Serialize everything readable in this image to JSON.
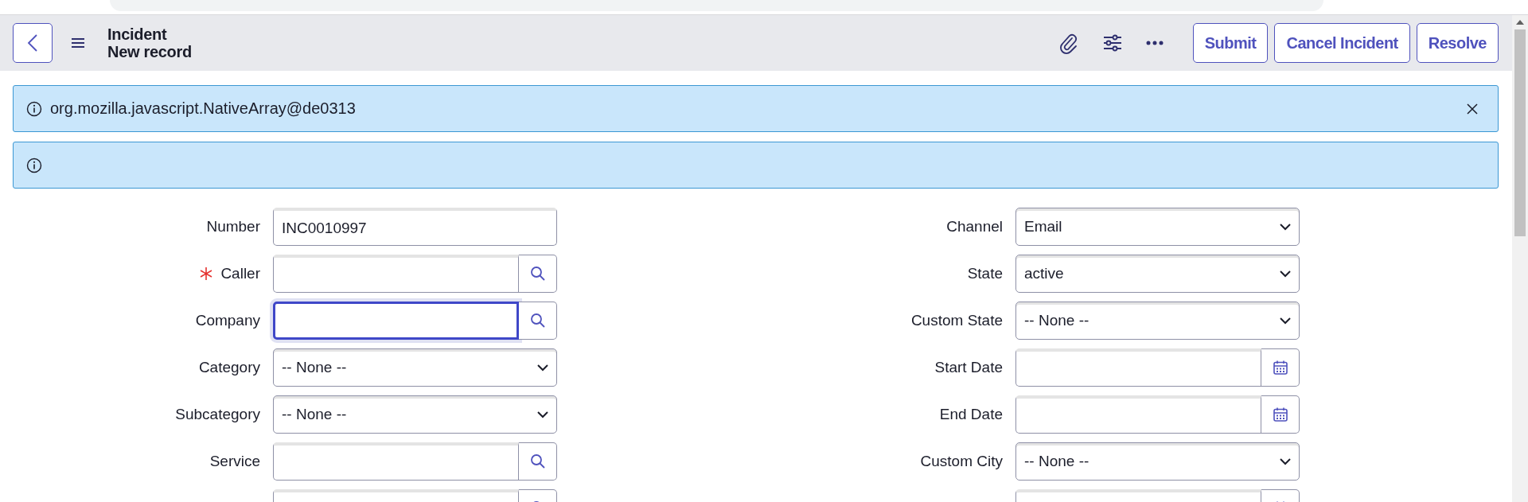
{
  "header": {
    "title": "Incident",
    "subtitle": "New record",
    "buttons": [
      {
        "label": "Submit"
      },
      {
        "label": "Cancel Incident"
      },
      {
        "label": "Resolve"
      }
    ]
  },
  "messages": [
    {
      "text": "org.mozilla.javascript.NativeArray@de0313",
      "closable": true
    },
    {
      "closable": false
    }
  ],
  "form": {
    "left": [
      {
        "label": "Number",
        "kind": "text",
        "value": "INC0010997",
        "required": false,
        "focused": false
      },
      {
        "label": "Caller",
        "kind": "lookup",
        "required": true,
        "focused": false
      },
      {
        "label": "Company",
        "kind": "lookup",
        "required": false,
        "focused": true
      },
      {
        "label": "Category",
        "kind": "select",
        "value": "-- None --",
        "required": false,
        "focused": false
      },
      {
        "label": "Subcategory",
        "kind": "select",
        "value": "-- None --",
        "required": false,
        "focused": false
      },
      {
        "label": "Service",
        "kind": "lookup",
        "required": false,
        "focused": false
      },
      {
        "kind": "lookup",
        "focused": false
      }
    ],
    "right": [
      {
        "label": "Channel",
        "kind": "select",
        "value": "Email",
        "required": false,
        "focused": false
      },
      {
        "label": "State",
        "kind": "select",
        "value": "active",
        "required": false,
        "focused": false
      },
      {
        "label": "Custom State",
        "kind": "select",
        "value": "-- None --",
        "required": false,
        "focused": false
      },
      {
        "label": "Start Date",
        "kind": "date",
        "required": false,
        "focused": false
      },
      {
        "label": "End Date",
        "kind": "date",
        "required": false,
        "focused": false
      },
      {
        "label": "Custom City",
        "kind": "select",
        "value": "-- None --",
        "required": false,
        "focused": false
      },
      {
        "kind": "date",
        "focused": false
      }
    ]
  }
}
